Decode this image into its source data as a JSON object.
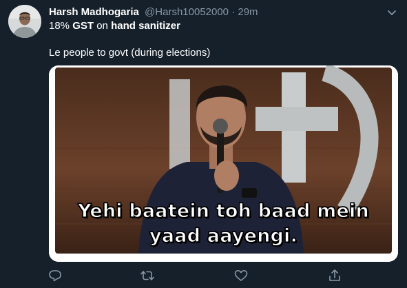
{
  "tweet": {
    "author_name": "Harsh Madhogaria",
    "author_handle": "@Harsh10052000",
    "separator": "·",
    "timestamp": "29m",
    "text_line1": {
      "part1": "18% ",
      "part2": "GST",
      "part3": " on ",
      "part4": "hand sanitizer"
    },
    "text_line2": "Le people to govt (during elections)",
    "media": {
      "caption_line1": "Yehi baatein toh baad mein",
      "caption_line2": "yaad aayengi."
    }
  },
  "actions": [
    {
      "icon": "reply-icon"
    },
    {
      "icon": "retweet-icon"
    },
    {
      "icon": "like-icon"
    },
    {
      "icon": "share-icon"
    }
  ],
  "colors": {
    "background": "#15202b",
    "text": "#ffffff",
    "secondary_text": "#8899a6"
  }
}
